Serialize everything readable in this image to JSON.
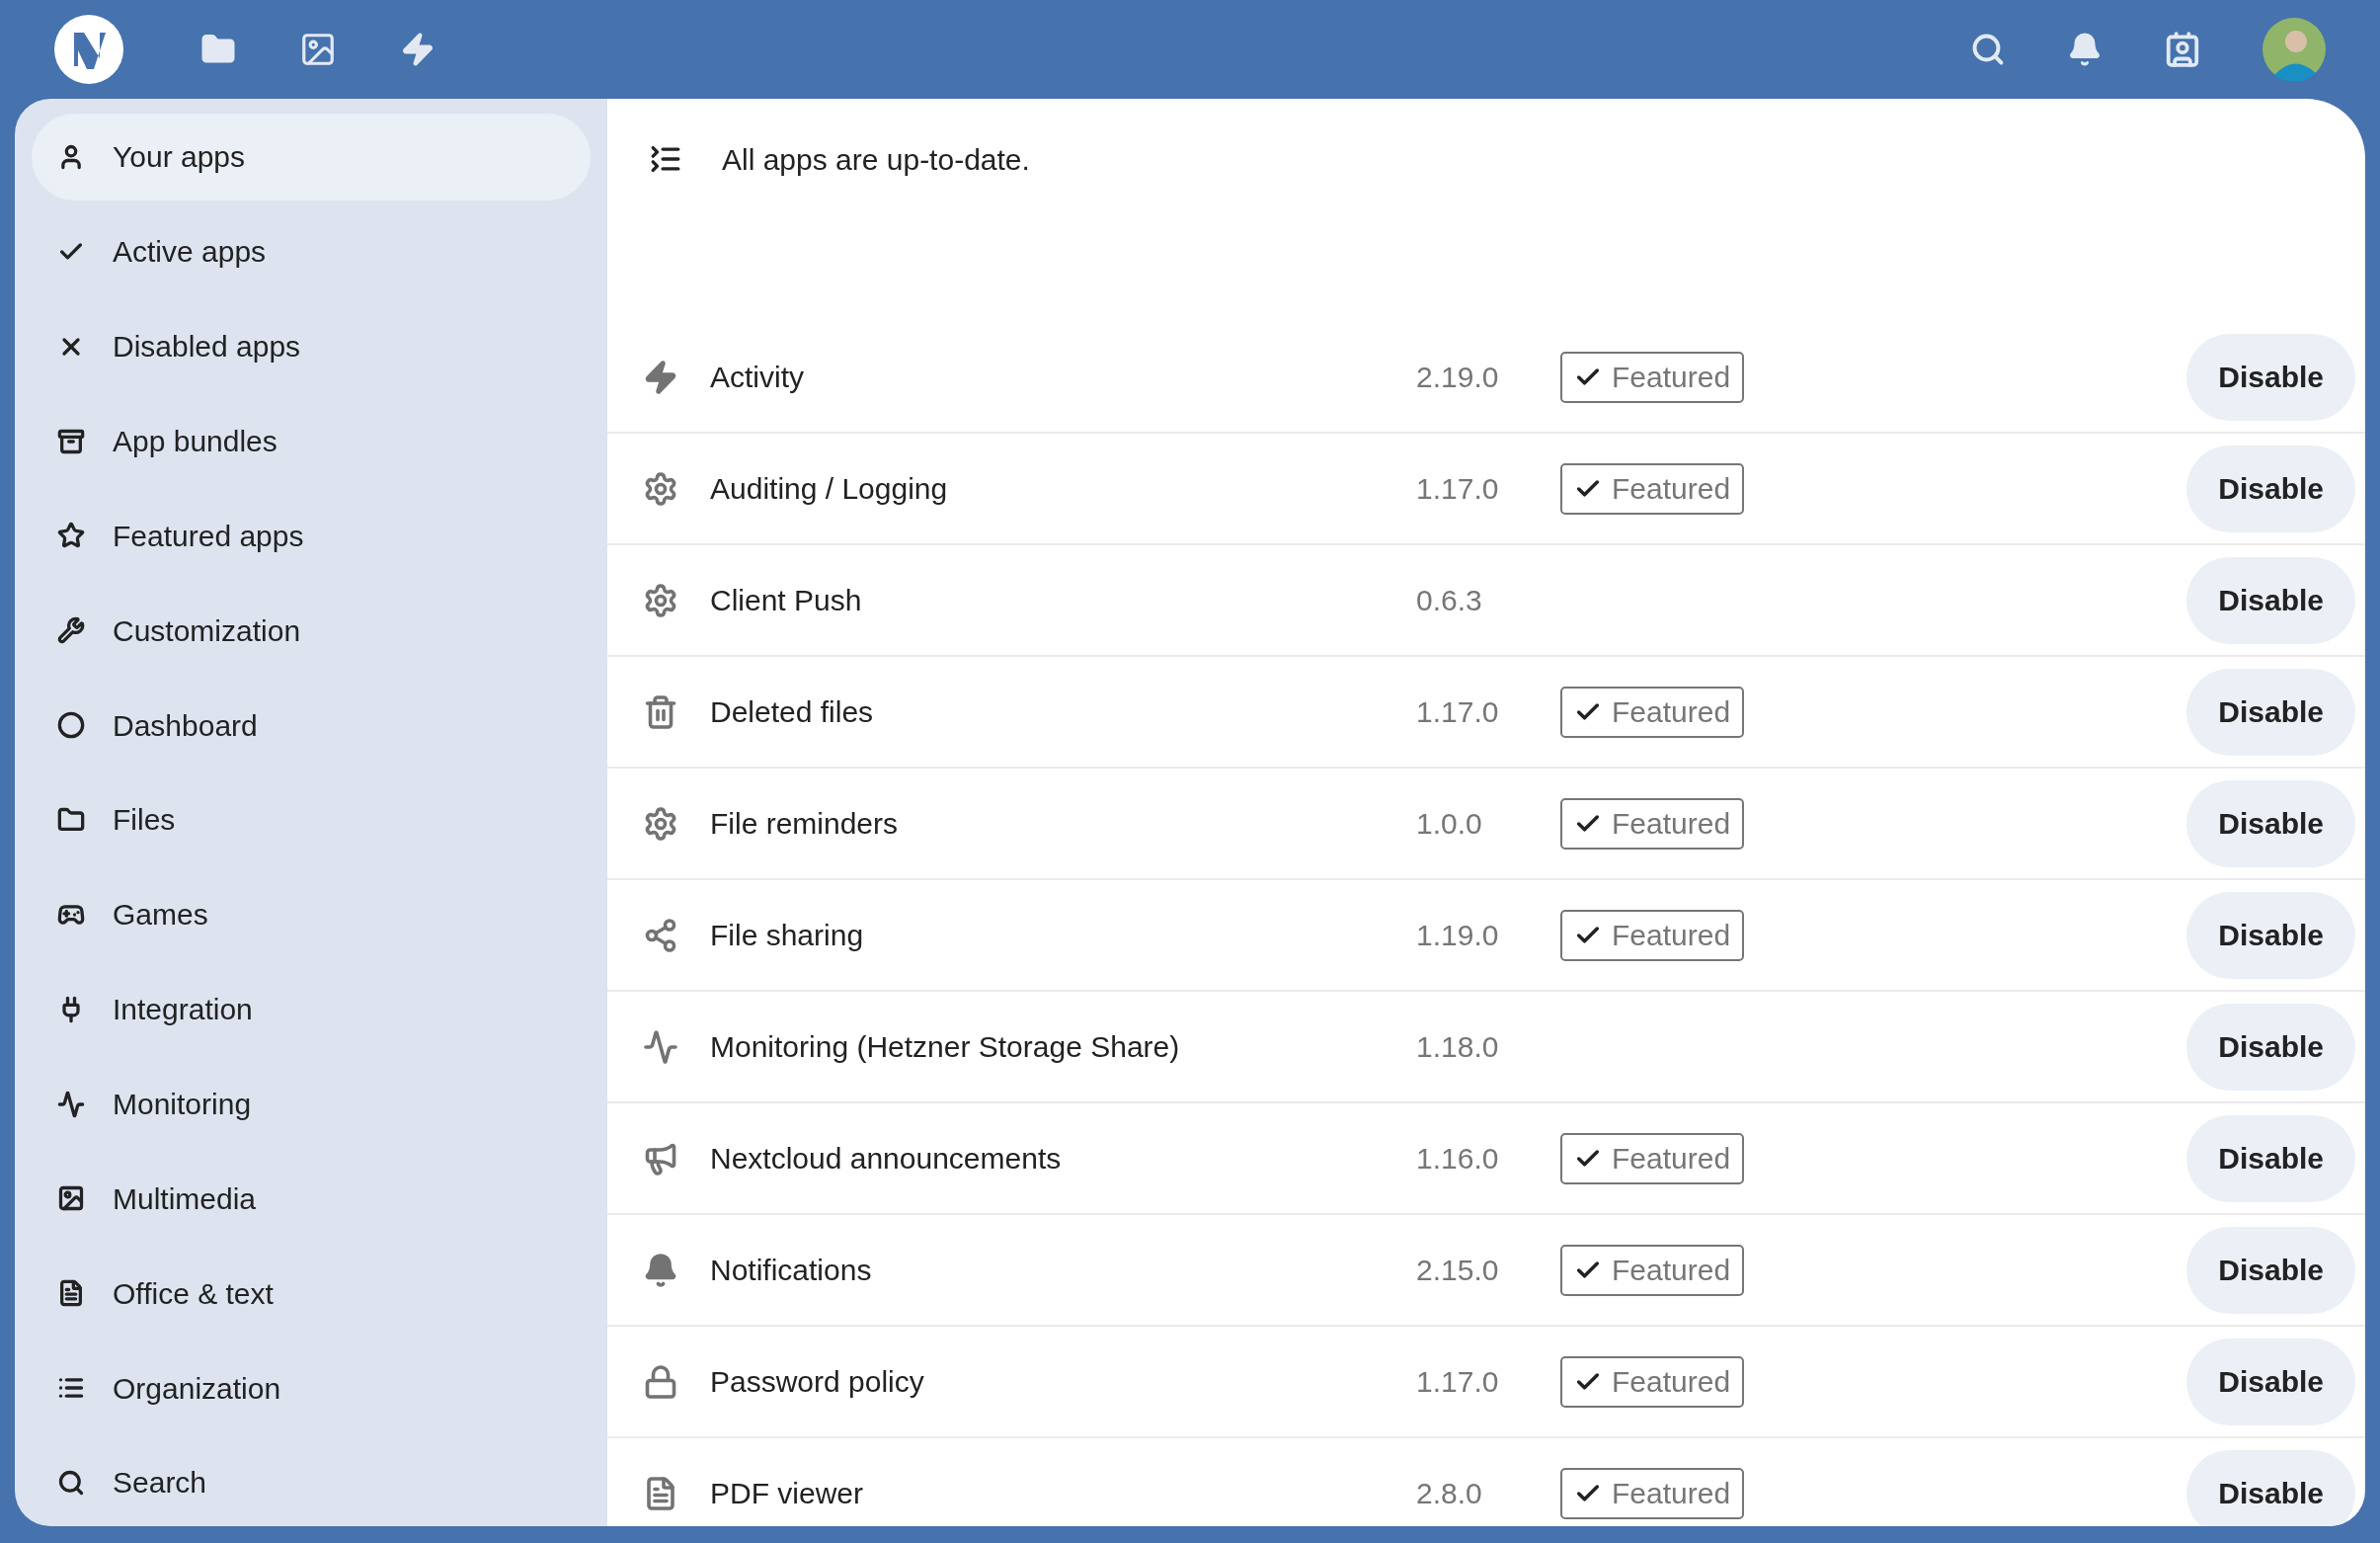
{
  "sidebar": {
    "items": [
      {
        "label": "Your apps",
        "selected": true
      },
      {
        "label": "Active apps",
        "selected": false
      },
      {
        "label": "Disabled apps",
        "selected": false
      },
      {
        "label": "App bundles",
        "selected": false
      },
      {
        "label": "Featured apps",
        "selected": false
      },
      {
        "label": "Customization",
        "selected": false
      },
      {
        "label": "Dashboard",
        "selected": false
      },
      {
        "label": "Files",
        "selected": false
      },
      {
        "label": "Games",
        "selected": false
      },
      {
        "label": "Integration",
        "selected": false
      },
      {
        "label": "Monitoring",
        "selected": false
      },
      {
        "label": "Multimedia",
        "selected": false
      },
      {
        "label": "Office & text",
        "selected": false
      },
      {
        "label": "Organization",
        "selected": false
      },
      {
        "label": "Search",
        "selected": false
      }
    ]
  },
  "status": "All apps are up-to-date.",
  "apps": [
    {
      "name": "Activity",
      "version": "2.19.0",
      "featured": true,
      "badge": "Featured",
      "button": "Disable"
    },
    {
      "name": "Auditing / Logging",
      "version": "1.17.0",
      "featured": true,
      "badge": "Featured",
      "button": "Disable"
    },
    {
      "name": "Client Push",
      "version": "0.6.3",
      "featured": false,
      "button": "Disable"
    },
    {
      "name": "Deleted files",
      "version": "1.17.0",
      "featured": true,
      "badge": "Featured",
      "button": "Disable"
    },
    {
      "name": "File reminders",
      "version": "1.0.0",
      "featured": true,
      "badge": "Featured",
      "button": "Disable"
    },
    {
      "name": "File sharing",
      "version": "1.19.0",
      "featured": true,
      "badge": "Featured",
      "button": "Disable"
    },
    {
      "name": "Monitoring (Hetzner Storage Share)",
      "version": "1.18.0",
      "featured": false,
      "button": "Disable"
    },
    {
      "name": "Nextcloud announcements",
      "version": "1.16.0",
      "featured": true,
      "badge": "Featured",
      "button": "Disable"
    },
    {
      "name": "Notifications",
      "version": "2.15.0",
      "featured": true,
      "badge": "Featured",
      "button": "Disable"
    },
    {
      "name": "Password policy",
      "version": "1.17.0",
      "featured": true,
      "badge": "Featured",
      "button": "Disable"
    },
    {
      "name": "PDF viewer",
      "version": "2.8.0",
      "featured": true,
      "badge": "Featured",
      "button": "Disable"
    }
  ]
}
